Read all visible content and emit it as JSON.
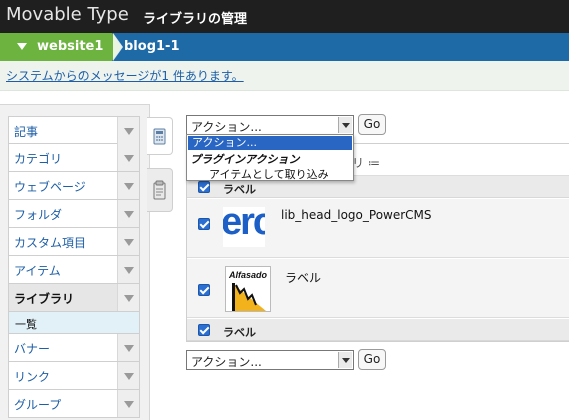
{
  "app": {
    "brand": "Movable Type",
    "page_title": "ライブラリの管理"
  },
  "scope": {
    "website": "website1",
    "blog": "blog1-1"
  },
  "message": {
    "text": "システムからのメッセージが1 件あります。"
  },
  "menu": {
    "items": [
      {
        "label": "記事"
      },
      {
        "label": "カテゴリ"
      },
      {
        "label": "ウェブページ"
      },
      {
        "label": "フォルダ"
      },
      {
        "label": "カスタム項目"
      },
      {
        "label": "アイテム"
      },
      {
        "label": "ライブラリ",
        "active": true
      },
      {
        "label": "バナー"
      },
      {
        "label": "リンク"
      },
      {
        "label": "グループ"
      }
    ],
    "submenu": {
      "label": "一覧"
    }
  },
  "actions": {
    "select_value": "アクション...",
    "go_label": "Go",
    "dropdown": {
      "selected": "アクション...",
      "group": "プラグインアクション",
      "option": "アイテムとして取り込み"
    }
  },
  "listing": {
    "view_label": "リ ≔",
    "header_label": "ラベル",
    "footer_label": "ラベル",
    "rows": [
      {
        "thumb_text": "erc",
        "label": "lib_head_logo_PowerCMS",
        "checked": true
      },
      {
        "thumb_text": "Alfasado",
        "label": "ラベル",
        "checked": true
      }
    ]
  },
  "colors": {
    "titlebar": "#1f1f1f",
    "scope_website": "#6db33f",
    "scope_blog": "#1d6aa6",
    "link": "#1d5ea6",
    "checkbox": "#2a6fd1"
  }
}
